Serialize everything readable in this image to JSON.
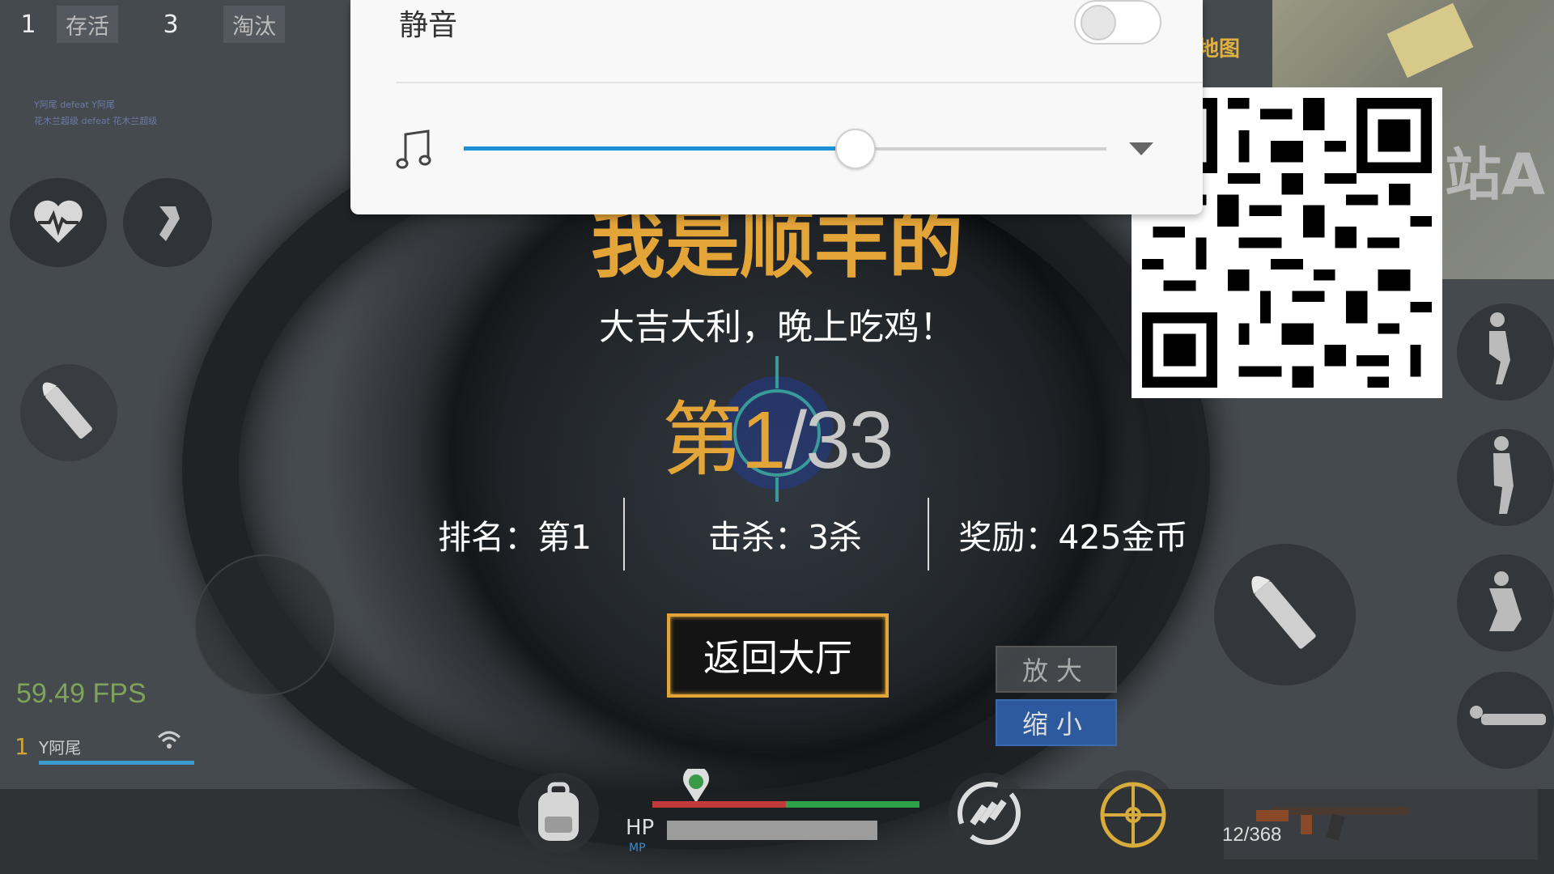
{
  "hud": {
    "alive_count": "1",
    "alive_label": "存活",
    "eliminated_count": "3",
    "eliminated_label": "淘汰",
    "kill_feed": [
      "Y阿尾 defeat Y阿尾",
      "花木兰超级 defeat 花木兰超级"
    ]
  },
  "popup": {
    "mute_label": "静音",
    "mute_enabled": false,
    "volume_fraction": 0.61
  },
  "result": {
    "winner_name": "我是顺丰的",
    "subtitle": "大吉大利，晚上吃鸡！",
    "rank_prefix": "第1",
    "rank_suffix": "/33",
    "stats": {
      "rank": "排名：第1",
      "kills": "击杀：3杀",
      "reward": "奖励：425金币"
    },
    "back_button": "返回大厅"
  },
  "zoom": {
    "zoom_in": "放大",
    "zoom_out": "缩小"
  },
  "player": {
    "fps": "59.49 FPS",
    "team_number": "1",
    "name": "Y阿尾"
  },
  "bottom": {
    "hp_label": "HP",
    "mp_label": "MP",
    "ammo": "12/368"
  },
  "minimap": {
    "map_label": "地图",
    "area_label": "站A"
  },
  "colors": {
    "gold": "#e3a438",
    "slider_blue": "#1e8fd6",
    "zoom_out_blue": "#2d5a9e",
    "fps_green": "#7fa35a"
  },
  "icons": [
    "heart-rate-icon",
    "bandage-icon",
    "bullet-icon",
    "music-note-icon",
    "chevron-down-icon",
    "backpack-icon",
    "reload-icon",
    "crosshair-icon",
    "rifle-icon",
    "wifi-icon",
    "qr-code",
    "stand-icon",
    "crouch-icon",
    "prone-icon"
  ]
}
